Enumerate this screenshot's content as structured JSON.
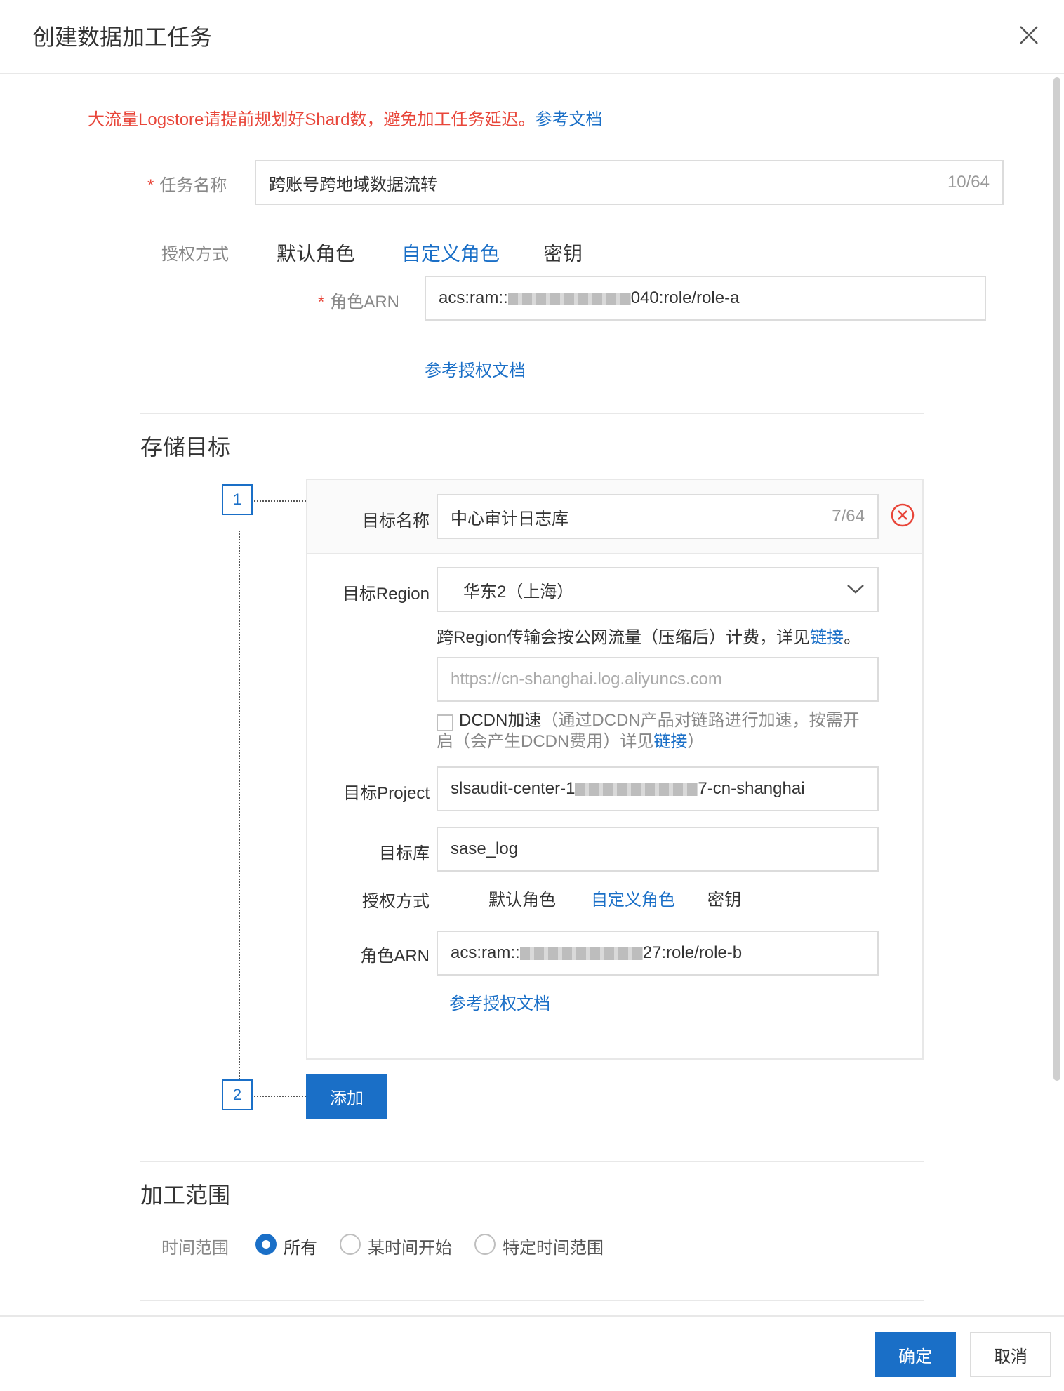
{
  "dialog": {
    "title": "创建数据加工任务"
  },
  "warning": {
    "text": "大流量Logstore请提前规划好Shard数，避免加工任务延迟。",
    "link": "参考文档"
  },
  "task": {
    "name_label": "任务名称",
    "name_value": "跨账号跨地域数据流转",
    "name_count": "10/64",
    "auth_label": "授权方式",
    "auth_tabs": [
      "默认角色",
      "自定义角色",
      "密钥"
    ],
    "auth_active": "自定义角色",
    "arn_label": "角色ARN",
    "arn_prefix": "acs:ram::",
    "arn_suffix": "040:role/role-a",
    "auth_doc_link": "参考授权文档"
  },
  "storage": {
    "section_title": "存储目标",
    "step1": "1",
    "step2": "2",
    "target_name_label": "目标名称",
    "target_name_value": "中心审计日志库",
    "target_name_count": "7/64",
    "region_label": "目标Region",
    "region_value": "华东2（上海）",
    "region_note": "跨Region传输会按公网流量（压缩后）计费，详见",
    "region_note_link": "链接",
    "region_note_end": "。",
    "endpoint_placeholder": "https://cn-shanghai.log.aliyuncs.com",
    "dcdn_label": "DCDN加速",
    "dcdn_note_line1": "（通过DCDN产品对链路进行加速，按需开",
    "dcdn_note_line2": "启（会产生DCDN费用）详见",
    "dcdn_note_link": "链接",
    "dcdn_note_end": "）",
    "project_label": "目标Project",
    "project_prefix": "slsaudit-center-1",
    "project_suffix": "7-cn-shanghai",
    "store_label": "目标库",
    "store_value": "sase_log",
    "auth_label": "授权方式",
    "auth_tabs": [
      "默认角色",
      "自定义角色",
      "密钥"
    ],
    "arn_label": "角色ARN",
    "arn_prefix": "acs:ram::",
    "arn_suffix": "27:role/role-b",
    "auth_doc_link": "参考授权文档",
    "add_button": "添加"
  },
  "scope": {
    "section_title": "加工范围",
    "time_label": "时间范围",
    "options": [
      "所有",
      "某时间开始",
      "特定时间范围"
    ],
    "selected": "所有"
  },
  "footer": {
    "confirm": "确定",
    "cancel": "取消"
  },
  "colors": {
    "primary": "#1a6fc7",
    "warning": "#e8463a",
    "border": "#dcdcdc"
  }
}
